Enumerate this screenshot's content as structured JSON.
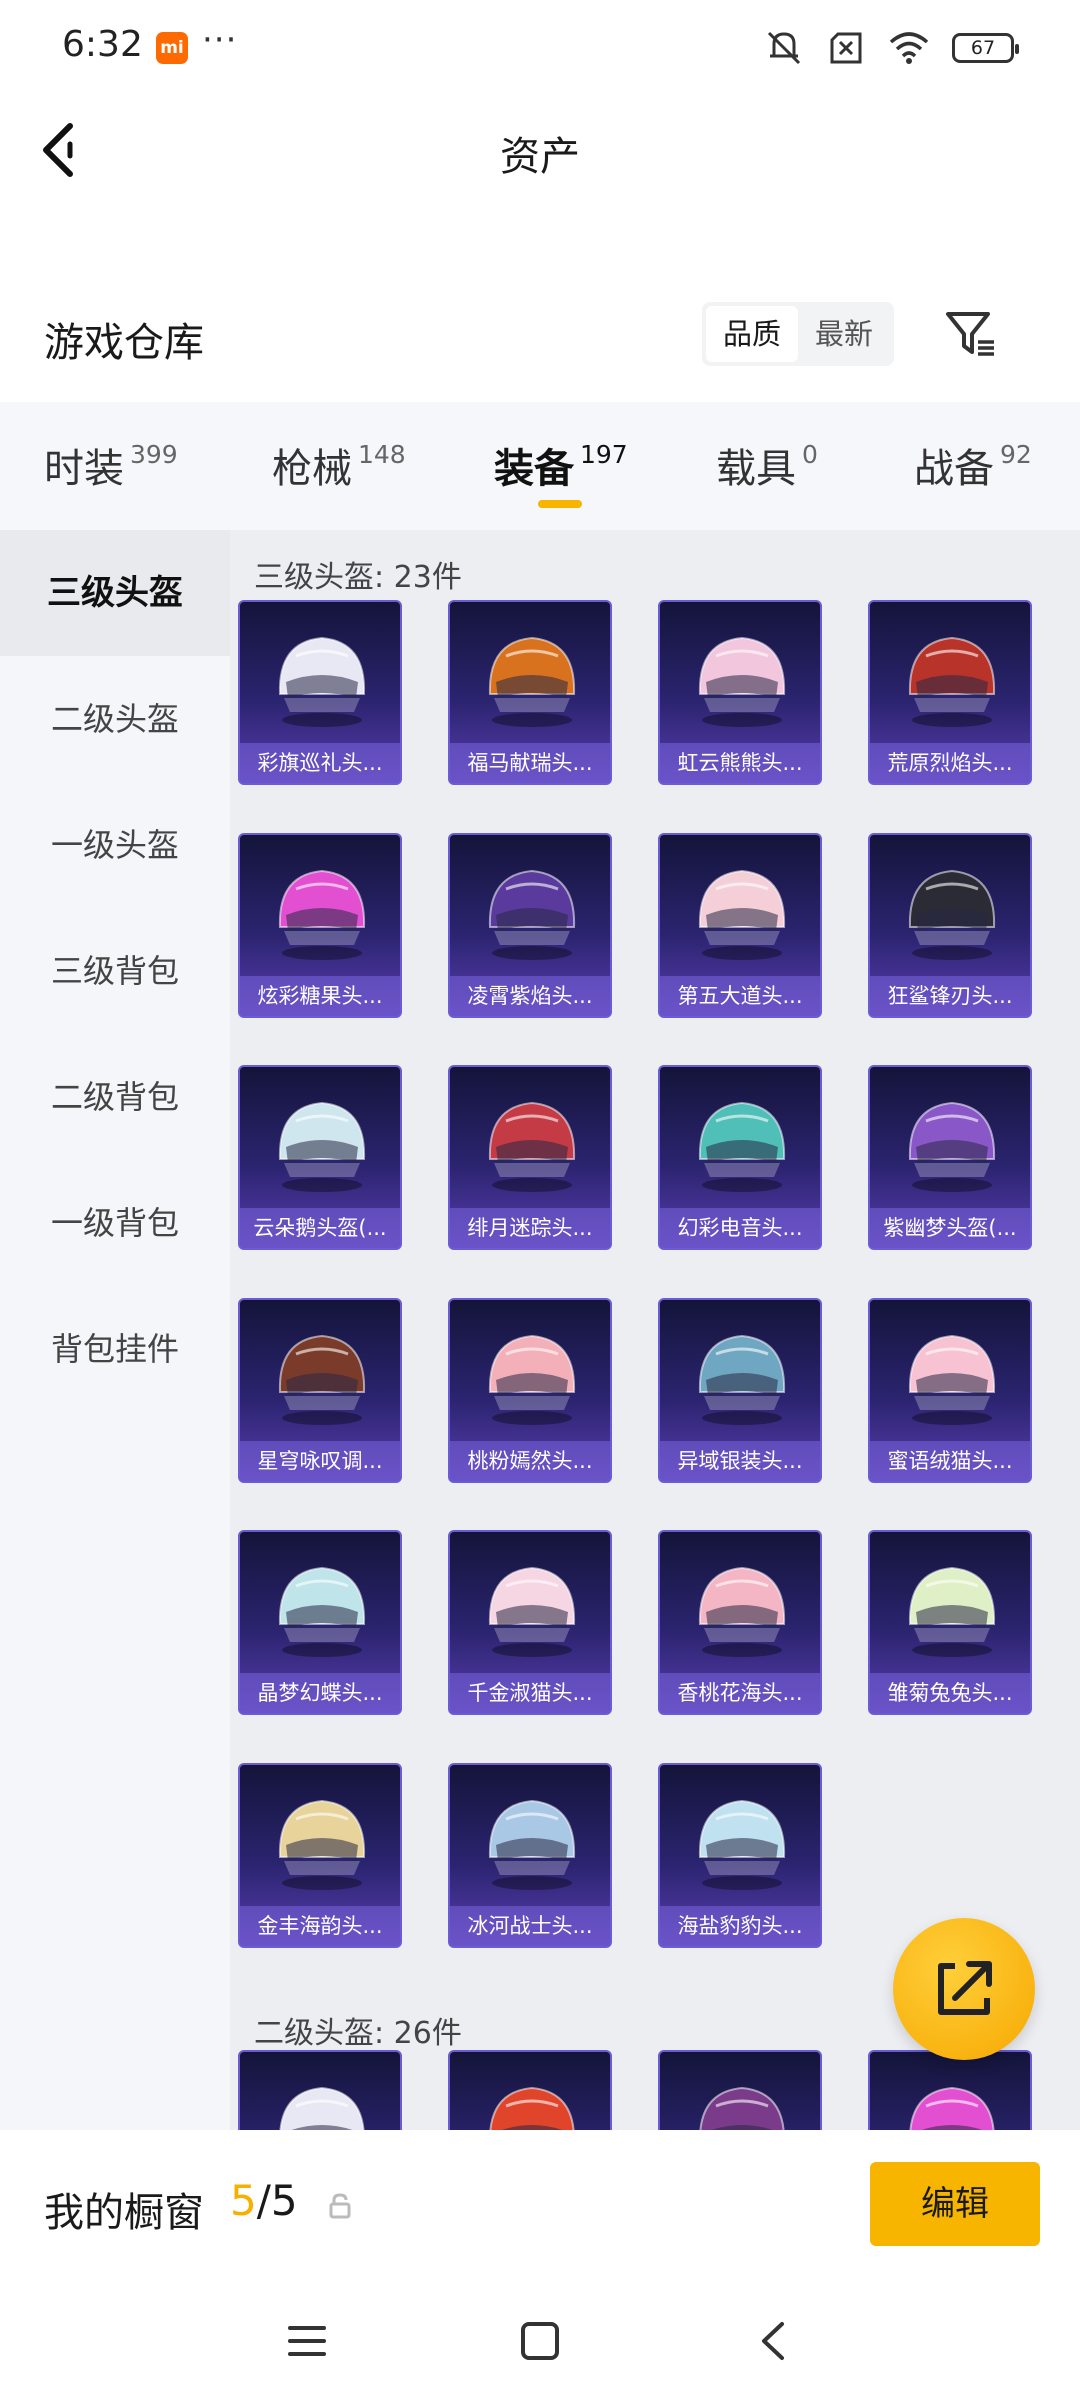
{
  "status_bar": {
    "time": "6:32",
    "battery": "67",
    "mi_badge": "mi",
    "overflow": "···"
  },
  "header": {
    "title": "资产"
  },
  "warehouse": {
    "title": "游戏仓库",
    "sort_options": [
      "品质",
      "最新"
    ],
    "active_sort": "品质"
  },
  "tabs": [
    {
      "label": "时装",
      "count": "399"
    },
    {
      "label": "枪械",
      "count": "148"
    },
    {
      "label": "装备",
      "count": "197"
    },
    {
      "label": "载具",
      "count": "0"
    },
    {
      "label": "战备",
      "count": "92"
    }
  ],
  "active_tab": "装备",
  "side_nav": [
    {
      "label": "三级头盔"
    },
    {
      "label": "二级头盔"
    },
    {
      "label": "一级头盔"
    },
    {
      "label": "三级背包"
    },
    {
      "label": "二级背包"
    },
    {
      "label": "一级背包"
    },
    {
      "label": "背包挂件"
    }
  ],
  "active_side": "三级头盔",
  "groups": [
    {
      "title": "三级头盔: 23件",
      "items": [
        {
          "name": "彩旗巡礼头...",
          "color": "#e8e8f5"
        },
        {
          "name": "福马献瑞头...",
          "color": "#d9721e"
        },
        {
          "name": "虹云熊熊头...",
          "color": "#f2c6dc"
        },
        {
          "name": "荒原烈焰头...",
          "color": "#b8332a"
        },
        {
          "name": "炫彩糖果头...",
          "color": "#e24fd0"
        },
        {
          "name": "凌霄紫焰头...",
          "color": "#5a3a9c"
        },
        {
          "name": "第五大道头...",
          "color": "#f5cfd8"
        },
        {
          "name": "狂鲨锋刃头...",
          "color": "#2b2b35"
        },
        {
          "name": "云朵鹅头盔(...",
          "color": "#cfe6ee"
        },
        {
          "name": "绯月迷踪头...",
          "color": "#c43a45"
        },
        {
          "name": "幻彩电音头...",
          "color": "#4fbfb8"
        },
        {
          "name": "紫幽梦头盔(...",
          "color": "#8a57c9"
        },
        {
          "name": "星穹咏叹调...",
          "color": "#7a3b2a"
        },
        {
          "name": "桃粉嫣然头...",
          "color": "#f4b0b8"
        },
        {
          "name": "异域银装头...",
          "color": "#6fa7c2"
        },
        {
          "name": "蜜语绒猫头...",
          "color": "#f7c2d2"
        },
        {
          "name": "晶梦幻蝶头...",
          "color": "#bfe4ea"
        },
        {
          "name": "千金淑猫头...",
          "color": "#f6d6e2"
        },
        {
          "name": "香桃花海头...",
          "color": "#f4b6c4"
        },
        {
          "name": "雏菊兔兔头...",
          "color": "#dff0c6"
        },
        {
          "name": "金丰海韵头...",
          "color": "#e8d39a"
        },
        {
          "name": "冰河战士头...",
          "color": "#a8c8e6"
        },
        {
          "name": "海盐豹豹头...",
          "color": "#bfe1f0"
        }
      ]
    },
    {
      "title": "二级头盔: 26件",
      "items": [
        {
          "name": "",
          "color": "#e8e8f5"
        },
        {
          "name": "",
          "color": "#e0452c"
        },
        {
          "name": "",
          "color": "#7a3b8a"
        },
        {
          "name": "",
          "color": "#e24fd0"
        }
      ]
    }
  ],
  "showcase": {
    "label": "我的橱窗",
    "current": "5",
    "separator": "/",
    "total": "5",
    "edit_label": "编辑"
  }
}
